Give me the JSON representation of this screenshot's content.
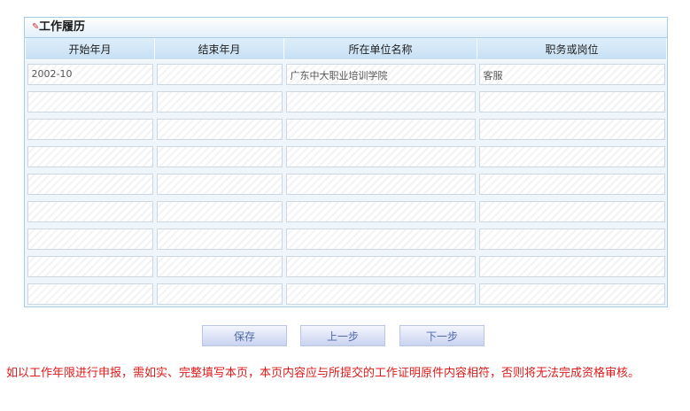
{
  "section": {
    "title": "工作履历"
  },
  "table": {
    "headers": [
      "开始年月",
      "结束年月",
      "所在单位名称",
      "职务或岗位"
    ],
    "rows": [
      [
        "2002-10",
        "",
        "广东中大职业培训学院",
        "客服"
      ],
      [
        "",
        "",
        "",
        ""
      ],
      [
        "",
        "",
        "",
        ""
      ],
      [
        "",
        "",
        "",
        ""
      ],
      [
        "",
        "",
        "",
        ""
      ],
      [
        "",
        "",
        "",
        ""
      ],
      [
        "",
        "",
        "",
        ""
      ],
      [
        "",
        "",
        "",
        ""
      ],
      [
        "",
        "",
        "",
        ""
      ]
    ]
  },
  "buttons": {
    "save": "保存",
    "prev": "上一步",
    "next": "下一步"
  },
  "notice": "如以工作年限进行申报，需如实、完整填写本页，本页内容应与所提交的工作证明原件内容相符，否则将无法完成资格审核。"
}
